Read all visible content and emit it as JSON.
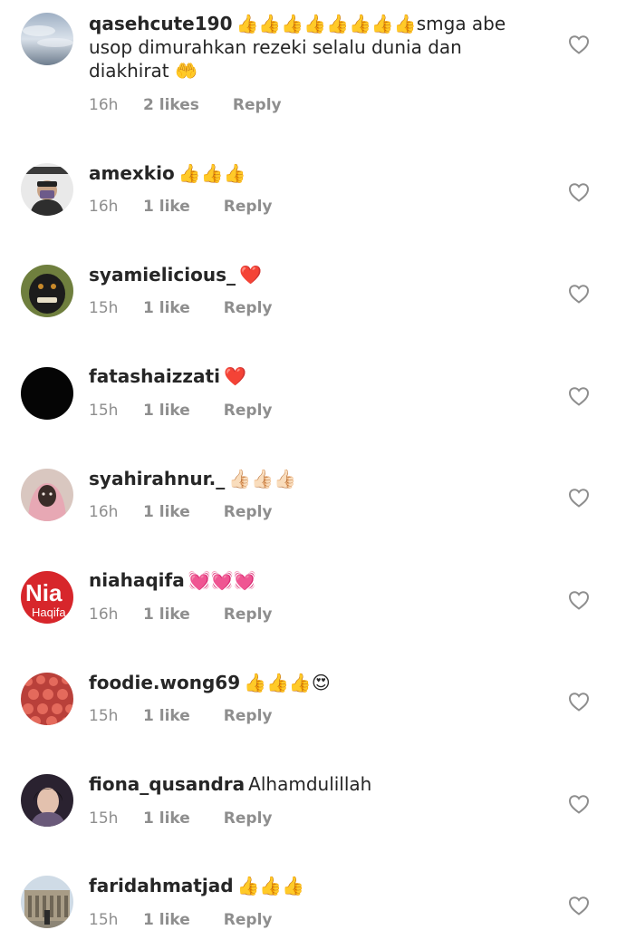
{
  "comments": [
    {
      "username": "qasehcute190",
      "text": "👍👍👍👍👍👍👍👍smga abe usop dimurahkan rezeki selalu dunia dan diakhirat 🤲",
      "time": "16h",
      "likes": "2 likes",
      "reply": "Reply"
    },
    {
      "username": "amexkio",
      "text": "👍👍👍",
      "time": "16h",
      "likes": "1 like",
      "reply": "Reply"
    },
    {
      "username": "syamielicious_",
      "text": "❤️",
      "time": "15h",
      "likes": "1 like",
      "reply": "Reply"
    },
    {
      "username": "fatashaizzati",
      "text": "❤️",
      "time": "15h",
      "likes": "1 like",
      "reply": "Reply"
    },
    {
      "username": "syahirahnur._",
      "text": "👍🏻👍🏻👍🏻",
      "time": "16h",
      "likes": "1 like",
      "reply": "Reply"
    },
    {
      "username": "niahaqifa",
      "text": "💓💓💓",
      "time": "16h",
      "likes": "1 like",
      "reply": "Reply",
      "avatar_text": "Nia",
      "avatar_subtext": "Haqifa"
    },
    {
      "username": "foodie.wong69",
      "text": "👍👍👍😍",
      "time": "15h",
      "likes": "1 like",
      "reply": "Reply"
    },
    {
      "username": "fiona_qusandra",
      "text": "Alhamdulillah",
      "time": "15h",
      "likes": "1 like",
      "reply": "Reply"
    },
    {
      "username": "faridahmatjad",
      "text": "👍👍👍",
      "time": "15h",
      "likes": "1 like",
      "reply": "Reply"
    }
  ],
  "colors": {
    "username": "#262626",
    "meta": "#8e8e8e",
    "heart": "#8e8e8e",
    "nia_avatar": "#d7262b"
  }
}
